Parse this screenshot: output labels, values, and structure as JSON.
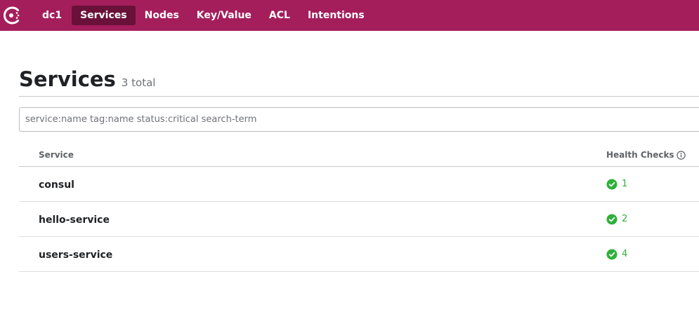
{
  "nav": {
    "datacenter": "dc1",
    "items": [
      {
        "label": "Services",
        "active": true
      },
      {
        "label": "Nodes",
        "active": false
      },
      {
        "label": "Key/Value",
        "active": false
      },
      {
        "label": "ACL",
        "active": false
      },
      {
        "label": "Intentions",
        "active": false
      }
    ]
  },
  "header": {
    "title": "Services",
    "count": "3 total"
  },
  "search": {
    "placeholder": "service:name tag:name status:critical search-term",
    "value": ""
  },
  "table": {
    "columns": {
      "service": "Service",
      "health": "Health Checks"
    },
    "rows": [
      {
        "name": "consul",
        "passing": "1"
      },
      {
        "name": "hello-service",
        "passing": "2"
      },
      {
        "name": "users-service",
        "passing": "4"
      }
    ]
  },
  "colors": {
    "brand": "#a41e5c",
    "nav_active": "#6a1139",
    "passing": "#2eb039"
  },
  "icons": {
    "logo": "consul-logo-icon",
    "info": "info-icon",
    "passing": "check-circle-icon"
  }
}
